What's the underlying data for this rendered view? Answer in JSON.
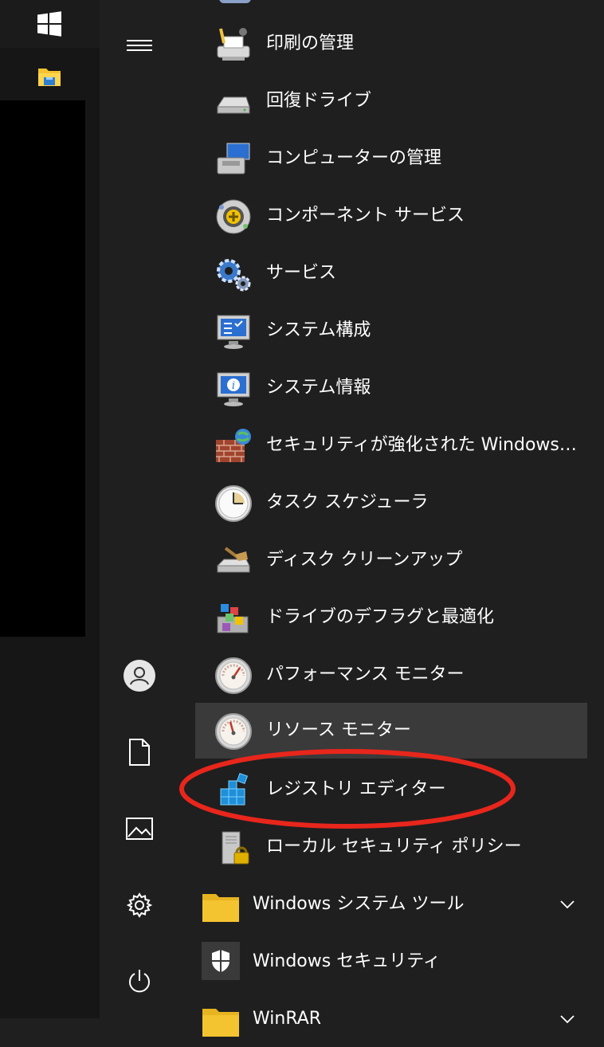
{
  "start_menu": {
    "items": [
      {
        "label": "印刷の管理",
        "icon": "print-management-icon"
      },
      {
        "label": "回復ドライブ",
        "icon": "recovery-drive-icon"
      },
      {
        "label": "コンピューターの管理",
        "icon": "computer-management-icon"
      },
      {
        "label": "コンポーネント サービス",
        "icon": "component-services-icon"
      },
      {
        "label": "サービス",
        "icon": "services-gears-icon"
      },
      {
        "label": "システム構成",
        "icon": "system-configuration-icon"
      },
      {
        "label": "システム情報",
        "icon": "system-information-icon"
      },
      {
        "label": "セキュリティが強化された Windows Def...",
        "icon": "firewall-icon"
      },
      {
        "label": "タスク スケジューラ",
        "icon": "task-scheduler-clock-icon"
      },
      {
        "label": "ディスク クリーンアップ",
        "icon": "disk-cleanup-icon"
      },
      {
        "label": "ドライブのデフラグと最適化",
        "icon": "defrag-icon"
      },
      {
        "label": "パフォーマンス モニター",
        "icon": "performance-monitor-gauge-icon"
      },
      {
        "label": "リソース モニター",
        "icon": "resource-monitor-gauge-icon"
      },
      {
        "label": "レジストリ エディター",
        "icon": "registry-editor-icon"
      },
      {
        "label": "ローカル セキュリティ ポリシー",
        "icon": "local-security-policy-icon"
      }
    ],
    "groups": [
      {
        "label": "Windows システム ツール",
        "icon": "folder-icon"
      },
      {
        "label": "Windows セキュリティ",
        "icon": "windows-security-shield-icon"
      },
      {
        "label": "WinRAR",
        "icon": "folder-icon"
      }
    ],
    "hovered_item": "リソース モニター",
    "annotated_item": "レジストリ エディター"
  },
  "colors": {
    "background": "#1f1f1f",
    "taskbar": "#161616",
    "hover": "#3a3a3a",
    "annotation": "#e8261c",
    "folder": "#f4c430"
  }
}
